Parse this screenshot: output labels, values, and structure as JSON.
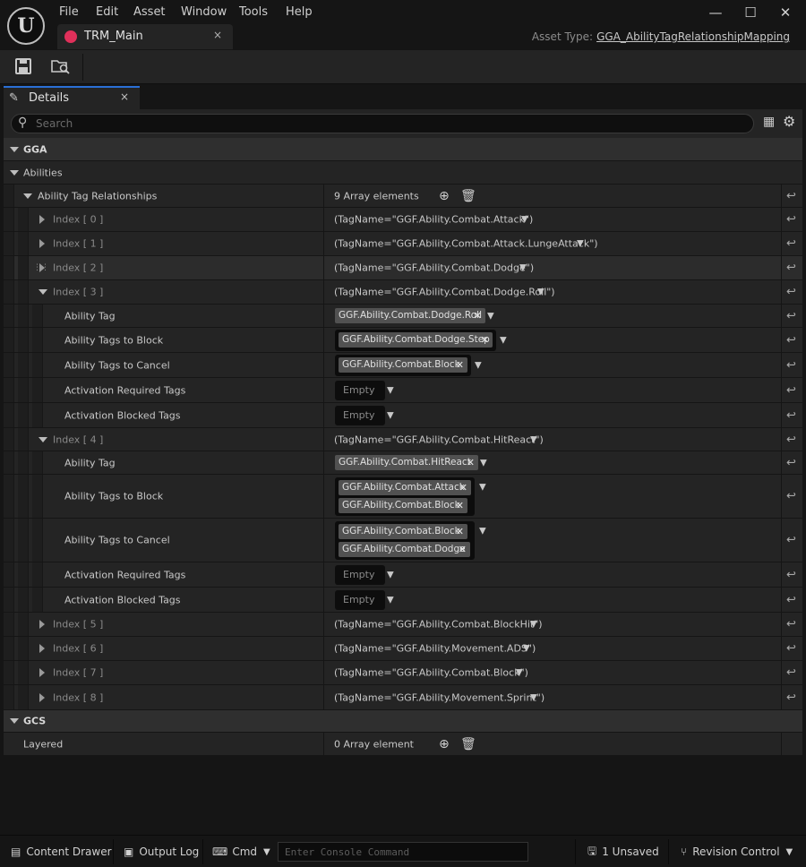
{
  "menu": [
    "File",
    "Edit",
    "Asset",
    "Window",
    "Tools",
    "Help"
  ],
  "window_controls": {
    "minimize": "—",
    "maximize": "☐",
    "close": "✕"
  },
  "document_tab": {
    "label": "TRM_Main",
    "close": "×"
  },
  "asset_type": {
    "label": "Asset Type:",
    "value": "GGA_AbilityTagRelationshipMapping"
  },
  "details_tab": {
    "label": "Details",
    "close": "×"
  },
  "search": {
    "placeholder": "Search"
  },
  "categories": {
    "gga": "GGA",
    "abilities": "Abilities",
    "gcs": "GCS"
  },
  "ability_tag_relationships": {
    "label": "Ability Tag Relationships",
    "count": "9 Array elements"
  },
  "indices": [
    {
      "label": "Index [ 0 ]",
      "value": "(TagName=\"GGF.Ability.Combat.Attack\")"
    },
    {
      "label": "Index [ 1 ]",
      "value": "(TagName=\"GGF.Ability.Combat.Attack.LungeAttack\")"
    },
    {
      "label": "Index [ 2 ]",
      "value": "(TagName=\"GGF.Ability.Combat.Dodge\")"
    },
    {
      "label": "Index [ 3 ]",
      "value": "(TagName=\"GGF.Ability.Combat.Dodge.Roll\")"
    },
    {
      "label": "Index [ 4 ]",
      "value": "(TagName=\"GGF.Ability.Combat.HitReact\")"
    },
    {
      "label": "Index [ 5 ]",
      "value": "(TagName=\"GGF.Ability.Combat.BlockHit\")"
    },
    {
      "label": "Index [ 6 ]",
      "value": "(TagName=\"GGF.Ability.Movement.ADS\")"
    },
    {
      "label": "Index [ 7 ]",
      "value": "(TagName=\"GGF.Ability.Combat.Block\")"
    },
    {
      "label": "Index [ 8 ]",
      "value": "(TagName=\"GGF.Ability.Movement.Sprint\")"
    }
  ],
  "fields": {
    "ability_tag": "Ability Tag",
    "tags_to_block": "Ability Tags to Block",
    "tags_to_cancel": "Ability Tags to Cancel",
    "activation_required": "Activation Required Tags",
    "activation_blocked": "Activation Blocked Tags"
  },
  "index3": {
    "ability_tag": "GGF.Ability.Combat.Dodge.Roll",
    "tags_to_block": [
      "GGF.Ability.Combat.Dodge.Step"
    ],
    "tags_to_cancel": [
      "GGF.Ability.Combat.Block"
    ]
  },
  "index4": {
    "ability_tag": "GGF.Ability.Combat.HitReact",
    "tags_to_block": [
      "GGF.Ability.Combat.Attack",
      "GGF.Ability.Combat.Block"
    ],
    "tags_to_cancel": [
      "GGF.Ability.Combat.Block",
      "GGF.Ability.Combat.Dodge"
    ]
  },
  "empty_label": "Empty",
  "layered": {
    "label": "Layered",
    "count": "0 Array element"
  },
  "statusbar": {
    "content_drawer": "Content Drawer",
    "output_log": "Output Log",
    "cmd": "Cmd",
    "console_placeholder": "Enter Console Command",
    "unsaved": "1 Unsaved",
    "revision_control": "Revision Control"
  },
  "colors": {
    "accent": "#2a6fd6",
    "tab_icon": "#e0305a"
  }
}
